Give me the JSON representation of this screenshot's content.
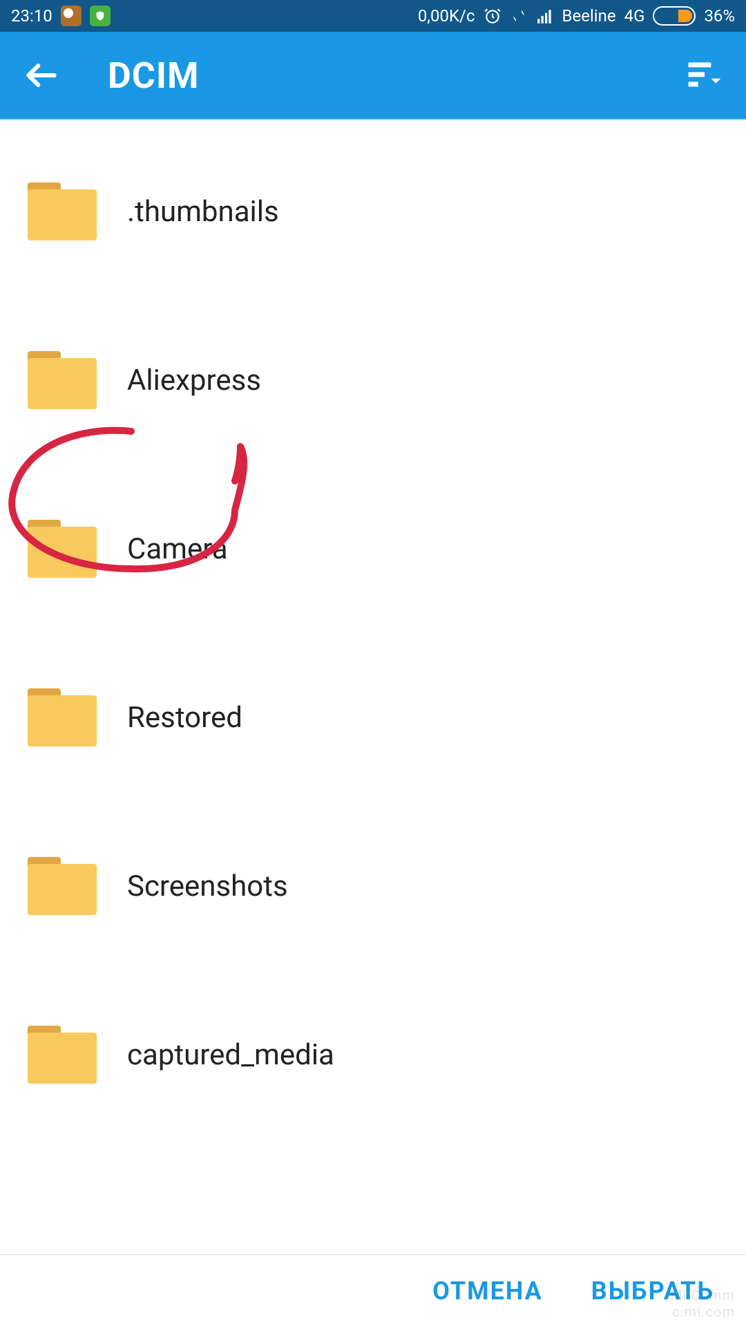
{
  "status": {
    "time": "23:10",
    "net_speed": "0,00K/c",
    "carrier": "Beeline",
    "network_type": "4G",
    "battery_percent": "36%"
  },
  "header": {
    "title": "DCIM"
  },
  "folders": {
    "items": [
      {
        "label": ".thumbnails"
      },
      {
        "label": "Aliexpress"
      },
      {
        "label": "Camera"
      },
      {
        "label": "Restored"
      },
      {
        "label": "Screenshots"
      },
      {
        "label": "captured_media"
      }
    ]
  },
  "buttons": {
    "cancel": "ОТМЕНА",
    "select": "ВЫБРАТЬ"
  },
  "annotation": {
    "circled_item": "Camera",
    "color": "#d62643"
  },
  "watermark": {
    "line1": "Mi Comm",
    "line2": "c.mi.com"
  }
}
